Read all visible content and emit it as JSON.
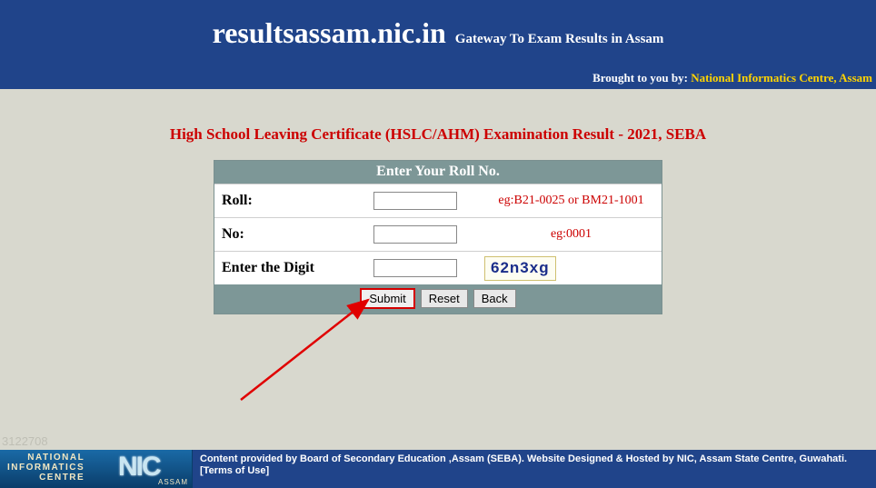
{
  "header": {
    "site_name": "resultsassam.nic.in",
    "tagline": "Gateway To Exam Results in Assam",
    "brought_label": "Brought to you by: ",
    "brought_link": "National Informatics Centre, Assam"
  },
  "page": {
    "title": "High School Leaving Certificate (HSLC/AHM) Examination Result - 2021, SEBA"
  },
  "form": {
    "header": "Enter Your Roll No.",
    "roll_label": "Roll:",
    "roll_hint": "eg:B21-0025 or BM21-1001",
    "no_label": "No:",
    "no_hint": "eg:0001",
    "digit_label": "Enter the Digit",
    "captcha": "62n3xg",
    "submit": "Submit",
    "reset": "Reset",
    "back": "Back"
  },
  "counter": "3122708",
  "footer": {
    "logo_line1": "NATIONAL",
    "logo_line2": "INFORMATICS",
    "logo_line3": "CENTRE",
    "logo_big": "NIC",
    "logo_sub": "ASSAM",
    "text_line1": "Content provided by Board of Secondary Education ,Assam (SEBA). Website Designed & Hosted by NIC, Assam State Centre, Guwahati.",
    "terms": "[Terms of Use]"
  }
}
